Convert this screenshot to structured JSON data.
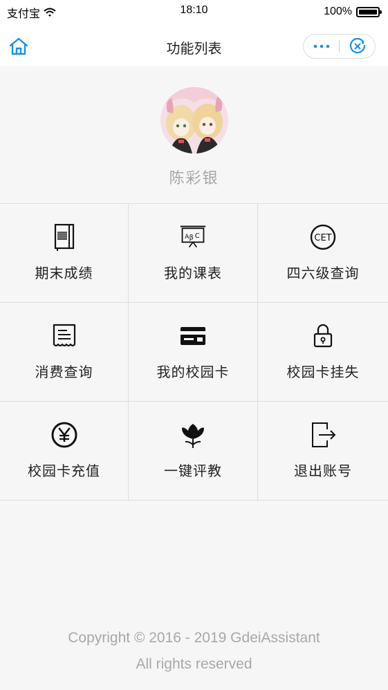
{
  "status_bar": {
    "carrier": "支付宝",
    "time": "18:10",
    "battery": "100%"
  },
  "nav": {
    "title": "功能列表",
    "home_icon": "home-icon",
    "more_icon": "more-dots-icon",
    "close_icon": "close-circle-icon",
    "accent_color": "#1a8fe3"
  },
  "profile": {
    "name": "陈彩银"
  },
  "menu": [
    {
      "label": "期末成绩",
      "icon": "notebook-icon"
    },
    {
      "label": "我的课表",
      "icon": "blackboard-icon"
    },
    {
      "label": "四六级查询",
      "icon": "cet-icon"
    },
    {
      "label": "消费查询",
      "icon": "receipt-icon"
    },
    {
      "label": "我的校园卡",
      "icon": "card-icon"
    },
    {
      "label": "校园卡挂失",
      "icon": "lock-icon"
    },
    {
      "label": "校园卡充值",
      "icon": "yen-icon"
    },
    {
      "label": "一键评教",
      "icon": "tulip-icon"
    },
    {
      "label": "退出账号",
      "icon": "logout-icon"
    }
  ],
  "footer": {
    "line1": "Copyright © 2016 - 2019 GdeiAssistant",
    "line2": "All rights reserved"
  }
}
